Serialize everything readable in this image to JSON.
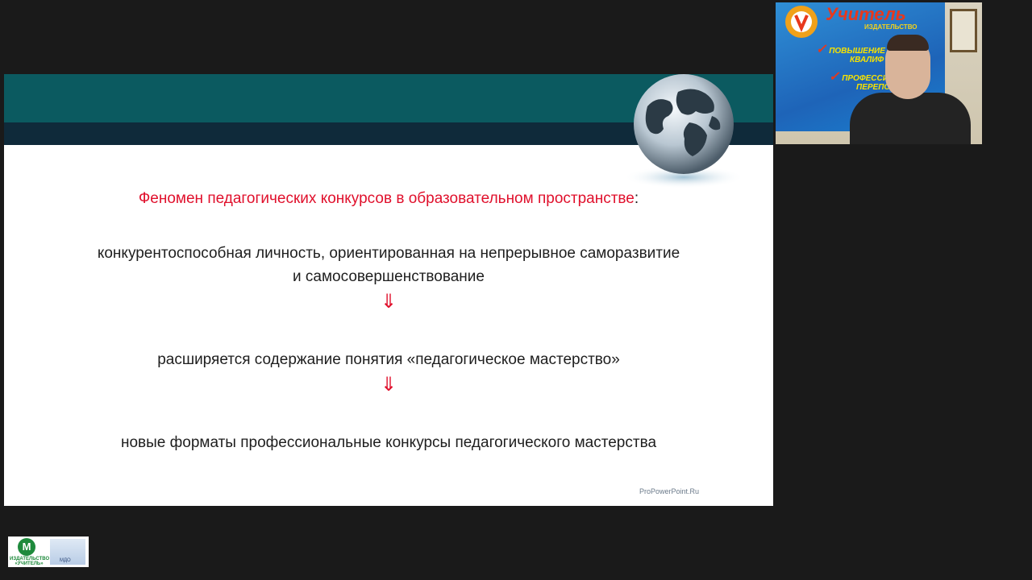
{
  "slide": {
    "heading_red": "Феномен педагогических конкурсов в образовательном пространстве",
    "heading_colon": ":",
    "line1": "конкурентоспособная личность, ориентированная на непрерывное саморазвитие",
    "line2": "и самосовершенствование",
    "arrow1": "⇓",
    "line3": "расширяется содержание понятия «педагогическое мастерство»",
    "arrow2": "⇓",
    "line4": "новые форматы профессиональные конкурсы педагогического мастерства",
    "watermark": "ProPowerPoint.Ru",
    "colors": {
      "teal_band": "#0b5a60",
      "dark_band": "#0f2a3a",
      "accent_red": "#e0102c"
    }
  },
  "webcam": {
    "banner_title": "Учитель",
    "banner_sub": "ИЗДАТЕЛЬСТВО",
    "banner_line1": "ПОВЫШЕНИЕ",
    "banner_line1b": "КВАЛИФ",
    "banner_line2": "ПРОФЕССИ",
    "banner_line2b": "ПЕРЕПО"
  },
  "logo": {
    "mark": "М",
    "text_top": "ИЗДАТЕЛЬСТВО",
    "text_bottom": "«УЧИТЕЛЬ»",
    "map_label": "МДО"
  }
}
